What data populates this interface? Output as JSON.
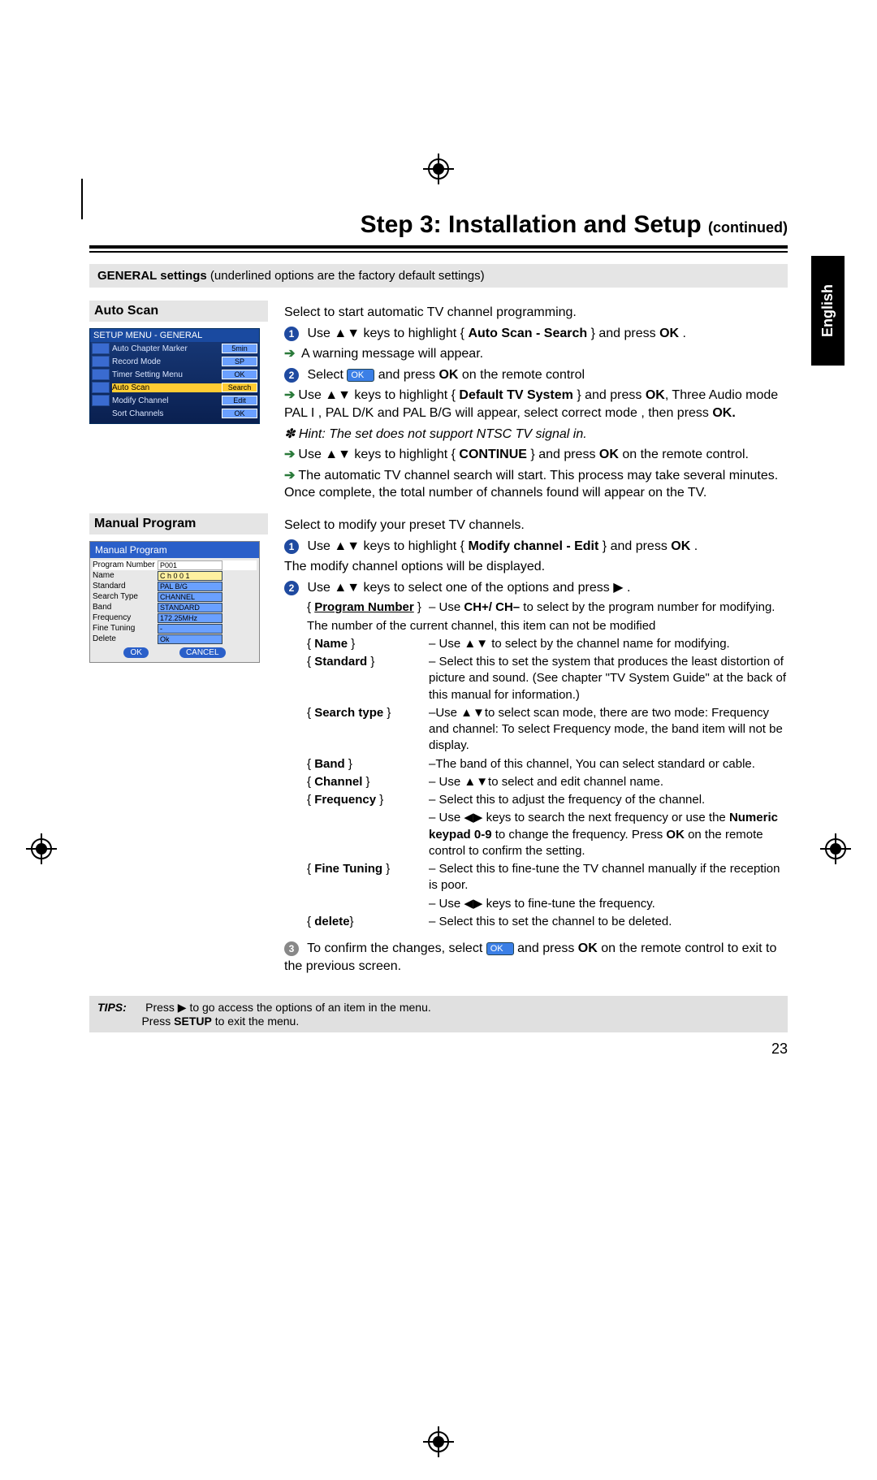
{
  "header": {
    "title": "Step 3: Installation and Setup",
    "continued": "(continued)"
  },
  "lang_tab": "English",
  "general_bar": {
    "bold": "GENERAL settings",
    "rest": " (underlined options are the factory default settings)"
  },
  "auto_scan": {
    "heading": "Auto Scan",
    "menu_title": "SETUP MENU - GENERAL",
    "menu_rows": [
      {
        "label": "Auto Chapter Marker",
        "val": "5min"
      },
      {
        "label": "Record Mode",
        "val": "SP"
      },
      {
        "label": "Timer Setting Menu",
        "val": "OK"
      },
      {
        "label": "Auto Scan",
        "val": "Search"
      },
      {
        "label": "Modify Channel",
        "val": "Edit"
      },
      {
        "label": "Sort Channels",
        "val": "OK"
      }
    ],
    "intro": "Select to start automatic TV channel programming.",
    "step1_a": "Use ▲▼ keys to highlight  { ",
    "step1_bold": "Auto Scan - Search",
    "step1_b": " } and press ",
    "step1_ok": "OK",
    "step1_c": " .",
    "step1_arrow": "A warning message will appear.",
    "step2_a": "Select ",
    "step2_ok_pill": "OK",
    "step2_b": " and press ",
    "step2_ok": "OK",
    "step2_c": " on the remote control",
    "sub1_a": "Use ▲▼ keys to highlight { ",
    "sub1_bold": "Default TV System",
    "sub1_b": " } and press ",
    "sub1_ok": "OK",
    "sub1_c": ", Three Audio mode PAL I , PAL D/K and PAL B/G will appear, select correct mode , then press ",
    "sub1_ok2": "OK.",
    "hint_star": "✽ ",
    "hint": "Hint: The set does not support NTSC TV signal in.",
    "sub2_a": "Use ▲▼ keys to highlight { ",
    "sub2_bold": "CONTINUE",
    "sub2_b": " } and press ",
    "sub2_ok": "OK",
    "sub2_c": " on the remote control.",
    "sub3": "The automatic TV channel search will start. This process may take several minutes. Once complete, the total number of channels found will appear on the TV."
  },
  "manual": {
    "heading": "Manual Program",
    "img_title": "Manual Program",
    "rows": [
      {
        "lab": "Program Number",
        "val": "P001"
      },
      {
        "lab": "Name",
        "val": "C h 0 0 1"
      },
      {
        "lab": "Standard",
        "val": "PAL B/G"
      },
      {
        "lab": "Search Type",
        "val": "CHANNEL"
      },
      {
        "lab": "Band",
        "val": "STANDARD"
      },
      {
        "lab": "Frequency",
        "val": "172.25MHz"
      },
      {
        "lab": "Fine Tuning",
        "val": "-"
      },
      {
        "lab": "Delete",
        "val": "Ok"
      }
    ],
    "btn_ok": "OK",
    "btn_cancel": "CANCEL",
    "intro": "Select to modify your preset TV channels.",
    "s1_a": "Use ▲▼ keys to highlight  { ",
    "s1_bold": "Modify channel - Edit",
    "s1_b": " } and press ",
    "s1_ok": "OK",
    "s1_c": " .",
    "s1_d": "The modify channel options will be displayed.",
    "s2": "Use ▲▼ keys to select one of the options and press ▶ .",
    "opts": {
      "prog_key": "Program Number",
      "prog_desc_a": "–  Use ",
      "prog_desc_b": "CH+/ CH–",
      "prog_desc_c": " to select by the program number for modifying.",
      "prog_note": "The number of the current channel, this item can not be modified",
      "name_key": "Name",
      "name_desc": "– Use ▲▼ to select by the channel name for modifying.",
      "std_key": "Standard",
      "std_desc": "– Select this to set the system that produces the least distortion of picture and sound. (See chapter \"TV System Guide\" at the back of this manual for information.)",
      "search_key": "Search type",
      "search_desc": "–Use  ▲▼to select scan mode, there are two mode: Frequency and channel: To select Frequency mode, the band item will not be display.",
      "band_key": "Band",
      "band_desc": "–The band of this channel, You can select standard or cable.",
      "chan_key": "Channel",
      "chan_desc": "– Use ▲▼to select and edit channel name.",
      "freq_key": "Frequency",
      "freq_desc_a": "– Select this to adjust the frequency of the channel.",
      "freq_desc_b1": "– Use ◀▶ keys to search the next frequency or use the ",
      "freq_desc_b_bold": "Numeric keypad 0-9",
      "freq_desc_b2": " to change the frequency. Press ",
      "freq_desc_b_ok": "OK",
      "freq_desc_b3": " on the remote control to confirm the setting.",
      "fine_key": "Fine Tuning",
      "fine_desc_a": "– Select this to fine-tune the TV channel manually if the reception is poor.",
      "fine_desc_b": "– Use ◀▶ keys to fine-tune the frequency.",
      "del_key": "delete",
      "del_desc": "– Select this to set the channel to be deleted."
    },
    "s3_a": "To confirm the changes, select ",
    "s3_pill": "OK",
    "s3_b": " and press ",
    "s3_ok": "OK",
    "s3_c": " on the remote control to exit to the previous screen."
  },
  "tips": {
    "label": "TIPS:",
    "l1_a": "Press ▶ to go access the options of an item in the menu.",
    "l2_a": "Press ",
    "l2_bold": "SETUP",
    "l2_b": " to exit the menu."
  },
  "page_number": "23"
}
